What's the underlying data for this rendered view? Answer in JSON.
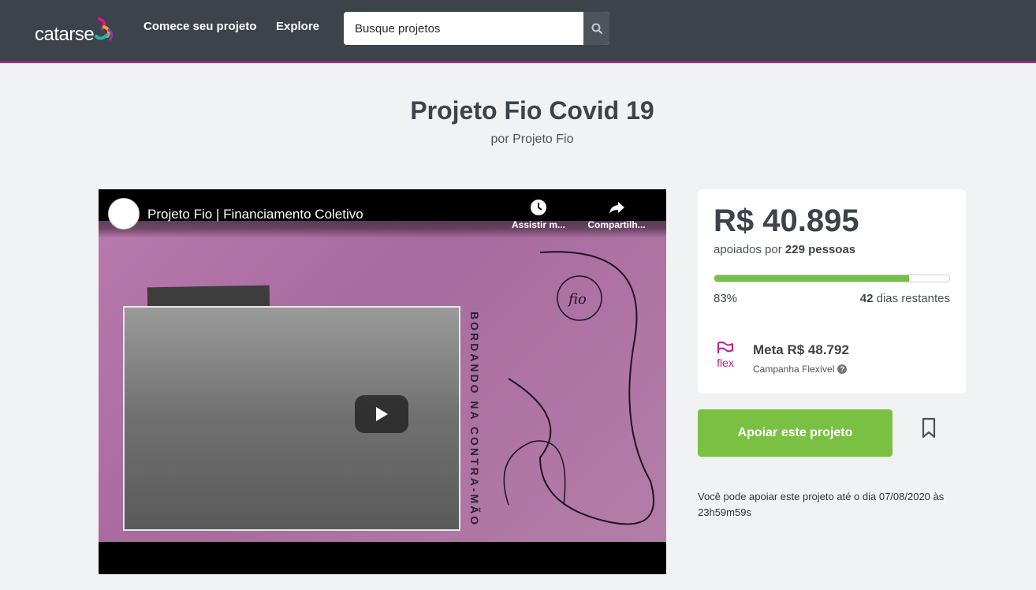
{
  "nav": {
    "logo_text": "catarse",
    "start_project": "Comece seu projeto",
    "explore": "Explore",
    "search_placeholder": "Busque projetos",
    "colors": {
      "bar": "#3c434b",
      "accent": "#9c2a86"
    }
  },
  "project": {
    "title": "Projeto Fio Covid 19",
    "owner": "por Projeto Fio"
  },
  "video": {
    "title": "Projeto Fio | Financiamento Coletivo",
    "watch_later": "Assistir m...",
    "share": "Compartilh...",
    "overlay_text": "BORDANDO NA CONTRA-MÃO",
    "logo_text": "fio"
  },
  "stats": {
    "pledged": "R$ 40.895",
    "backers_prefix": "apoiados por",
    "backers_count": "229 pessoas",
    "progress_percent": 83,
    "percent_label": "83%",
    "days_count": "42",
    "days_label": "dias restantes",
    "flex_badge": "flex",
    "goal": "Meta R$ 48.792",
    "campaign_type": "Campanha Flexível",
    "help_icon": "?"
  },
  "actions": {
    "support_label": "Apoiar este projeto",
    "support_color": "#7ac143",
    "deadline_text": "Você pode apoiar este projeto até o dia 07/08/2020 às 23h59m59s"
  }
}
